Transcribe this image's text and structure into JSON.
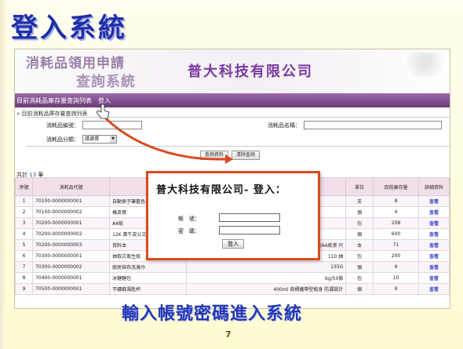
{
  "slide": {
    "title": "登入系統",
    "caption": "輸入帳號密碼進入系統",
    "page_number": "7"
  },
  "banner": {
    "system_name_line1": "消耗品領用申請",
    "system_name_line2": "查詢系統",
    "company": "普大科技有限公司"
  },
  "menu": {
    "item1": "目前消耗品庫存量查詢列表",
    "item2": "登入"
  },
  "breadcrumb": "» 目前消耗品庫存量查詢列表",
  "form": {
    "code_label": "消耗品編號：",
    "name_label": "消耗品名稱：",
    "category_label": "消耗品分類：",
    "category_value": "請選擇",
    "query_button": "查詢資料",
    "clear_button": "清除查詢"
  },
  "count": {
    "prefix": "共計",
    "value": "13",
    "suffix": "筆"
  },
  "table": {
    "headers": [
      "序號",
      "消耗品代號",
      "",
      "",
      "單位",
      "目前庫存量",
      "詳細資料"
    ],
    "rows": [
      {
        "no": "1",
        "code": "70100-0000000001",
        "name": "自動原子筆藍色",
        "extra": "",
        "unit": "支",
        "qty": "8",
        "link": "查看"
      },
      {
        "no": "2",
        "code": "70100-0000000002",
        "name": "橡皮擦",
        "extra": "",
        "unit": "個",
        "qty": "4",
        "link": "查看"
      },
      {
        "no": "3",
        "code": "70200-0000000001",
        "name": "A4紙",
        "extra": "",
        "unit": "包",
        "qty": "208",
        "link": "查看"
      },
      {
        "no": "4",
        "code": "70200-0000000002",
        "name": "12K 黃牛皮公文",
        "extra": "",
        "unit": "個",
        "qty": "600",
        "link": "查看"
      },
      {
        "no": "5",
        "code": "70200-0000000003",
        "name": "資料本",
        "extra": "放A4紙張 尺",
        "unit": "本",
        "qty": "71",
        "link": "查看"
      },
      {
        "no": "6",
        "code": "70300-0000000001",
        "name": "抽取式衛生紙",
        "extra": "110 抽",
        "unit": "包",
        "qty": "200",
        "link": "查看"
      },
      {
        "no": "7",
        "code": "70300-0000000002",
        "name": "廚房抹布洗滌巾",
        "extra": "135G",
        "unit": "個",
        "qty": "9",
        "link": "查看"
      },
      {
        "no": "8",
        "code": "70400-0000000001",
        "name": "冰糖糖包",
        "extra": "6g/50條",
        "unit": "包",
        "qty": "10",
        "link": "查看"
      },
      {
        "no": "9",
        "code": "70500-0000000001",
        "name": "不鏽鋼湯匙杯",
        "extra": "400ml 商標攜帶型瓶身 防漏設計",
        "unit": "個",
        "qty": "9",
        "link": "查看"
      }
    ]
  },
  "login_popup": {
    "title": "普大科技有限公司-  登入：",
    "account_label": "帳　號：",
    "password_label": "密　碼：",
    "login_button": "登入"
  },
  "colors": {
    "accent": "#d94a1c",
    "title_blue": "#1f2fa8",
    "menu_purple": "#7a4a88"
  }
}
